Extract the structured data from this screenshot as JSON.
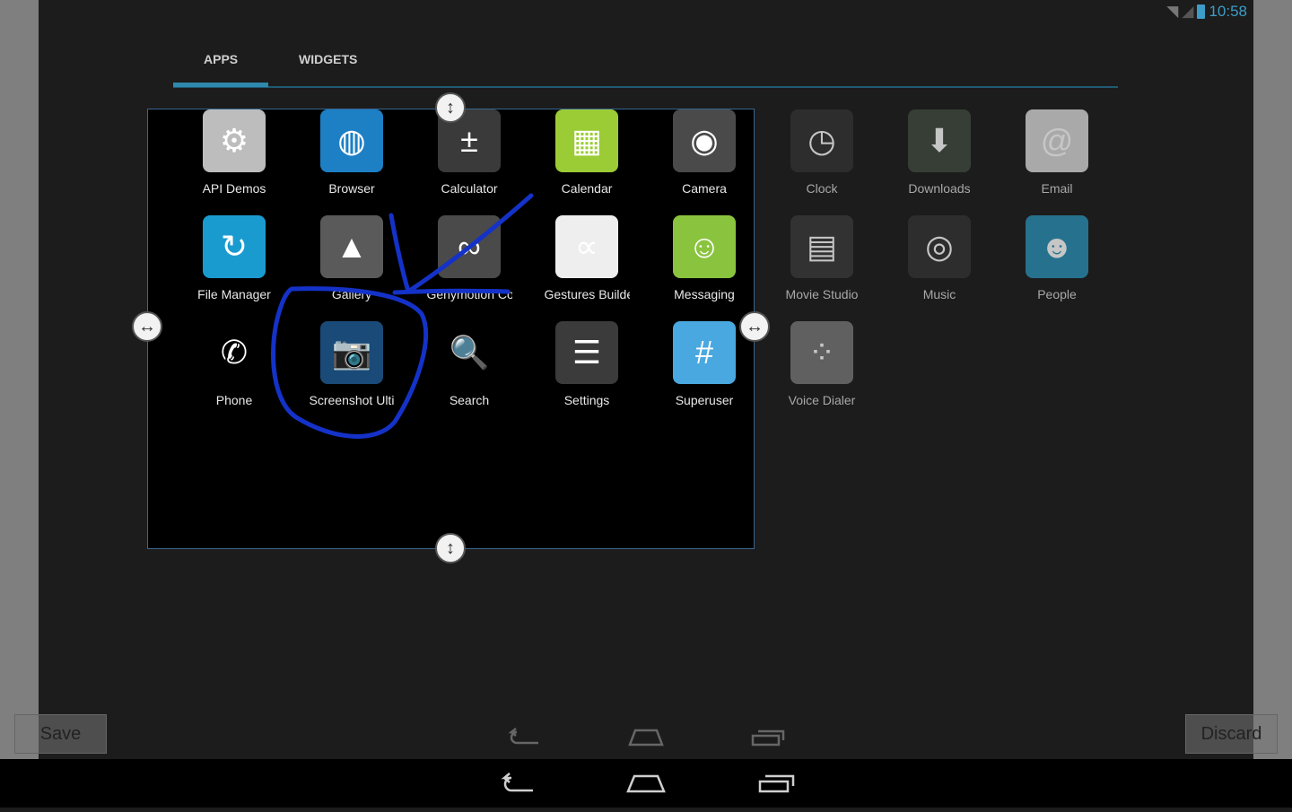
{
  "status_bar": {
    "time": "10:58",
    "icons": [
      "wifi-icon",
      "signal-icon",
      "battery-charging-icon"
    ]
  },
  "tabs": [
    {
      "label": "APPS",
      "selected": true
    },
    {
      "label": "WIDGETS",
      "selected": false
    }
  ],
  "apps": [
    {
      "label": "API Demos",
      "icon": "folder-gear-icon",
      "color": "#bdbdbd",
      "glyph": "⚙"
    },
    {
      "label": "Browser",
      "icon": "globe-icon",
      "color": "#1d7fc4",
      "glyph": "◍"
    },
    {
      "label": "Calculator",
      "icon": "calculator-icon",
      "color": "#3a3a3a",
      "glyph": "±"
    },
    {
      "label": "Calendar",
      "icon": "calendar-icon",
      "color": "#9ccc35",
      "glyph": "▦"
    },
    {
      "label": "Camera",
      "icon": "camera-icon",
      "color": "#4a4a4a",
      "glyph": "◉"
    },
    {
      "label": "Clock",
      "icon": "clock-icon",
      "color": "#333",
      "glyph": "◷"
    },
    {
      "label": "Downloads",
      "icon": "download-icon",
      "color": "#3f4a3f",
      "glyph": "⬇"
    },
    {
      "label": "Email",
      "icon": "email-icon",
      "color": "#d8d8d8",
      "glyph": "@"
    },
    {
      "label": "File Manager",
      "icon": "folder-sync-icon",
      "color": "#1a9bd0",
      "glyph": "↻"
    },
    {
      "label": "Gallery",
      "icon": "gallery-icon",
      "color": "#5a5a5a",
      "glyph": "▲"
    },
    {
      "label": "Genymotion Configure",
      "icon": "genymotion-icon",
      "color": "#4a4a4a",
      "glyph": "∞"
    },
    {
      "label": "Gestures Builder",
      "icon": "gestures-icon",
      "color": "#eeeeee",
      "glyph": "∝"
    },
    {
      "label": "Messaging",
      "icon": "message-icon",
      "color": "#8ac43f",
      "glyph": "☺"
    },
    {
      "label": "Movie Studio",
      "icon": "clapper-icon",
      "color": "#3a3a3a",
      "glyph": "▤"
    },
    {
      "label": "Music",
      "icon": "speaker-icon",
      "color": "#333",
      "glyph": "◎"
    },
    {
      "label": "People",
      "icon": "contacts-icon",
      "color": "#2a8fb5",
      "glyph": "☻"
    },
    {
      "label": "Phone",
      "icon": "phone-icon",
      "color": "transparent",
      "glyph": "✆"
    },
    {
      "label": "Screenshot Ultimate",
      "icon": "camera-icon",
      "color": "#1a4a78",
      "glyph": "📷"
    },
    {
      "label": "Search",
      "icon": "magnifier-icon",
      "color": "transparent",
      "glyph": "🔍"
    },
    {
      "label": "Settings",
      "icon": "sliders-icon",
      "color": "#3b3b3b",
      "glyph": "☰"
    },
    {
      "label": "Superuser",
      "icon": "hash-icon",
      "color": "#4aa8e0",
      "glyph": "#"
    },
    {
      "label": "Voice Dialer",
      "icon": "voice-dialer-icon",
      "color": "#777",
      "glyph": "⁘"
    }
  ],
  "buttons": {
    "save": "Save",
    "discard": "Discard"
  },
  "colors": {
    "accent": "#2e89ad",
    "annotation": "#1432c8"
  }
}
